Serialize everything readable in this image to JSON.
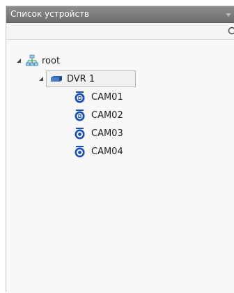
{
  "panel": {
    "title": "Список устройств"
  },
  "search": {
    "value": "",
    "placeholder": ""
  },
  "tree": {
    "root": {
      "label": "root"
    },
    "dvr": {
      "label": "DVR 1"
    },
    "cameras": [
      {
        "label": "CAM01",
        "icon": "camera-ptz-icon"
      },
      {
        "label": "CAM02",
        "icon": "camera-ptz-icon"
      },
      {
        "label": "CAM03",
        "icon": "camera-icon"
      },
      {
        "label": "CAM04",
        "icon": "camera-icon"
      }
    ]
  },
  "colors": {
    "title_bar": "#7a7a7a",
    "camera_blue": "#1a4fb5",
    "root_green": "#3aa35a"
  }
}
